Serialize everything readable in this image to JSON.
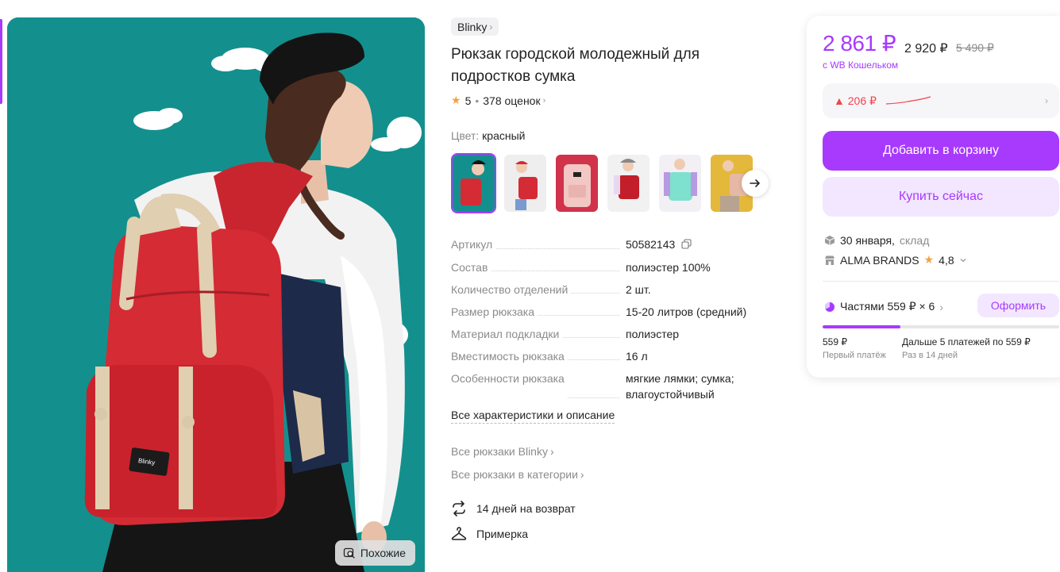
{
  "product": {
    "brand": "Blinky",
    "title": "Рюкзак городской молодежный для подростков сумка",
    "rating": "5",
    "reviews": "378 оценок",
    "color_label": "Цвет:",
    "color_value": "красный",
    "similar_label": "Похожие"
  },
  "specs": [
    {
      "key": "Артикул",
      "value": "50582143"
    },
    {
      "key": "Состав",
      "value": "полиэстер 100%"
    },
    {
      "key": "Количество отделений",
      "value": "2 шт."
    },
    {
      "key": "Размер рюкзака",
      "value": "15-20 литров (средний)"
    },
    {
      "key": "Материал подкладки",
      "value": "полиэстер"
    },
    {
      "key": "Вместимость рюкзака",
      "value": "16 л"
    },
    {
      "key": "Особенности рюкзака",
      "value": "мягкие лямки; сумка; влагоустойчивый"
    }
  ],
  "links": {
    "all_specs": "Все характеристики и описание",
    "all_brand": "Все рюкзаки Blinky",
    "all_category": "Все рюкзаки в категории"
  },
  "features": {
    "return": "14 дней на возврат",
    "fitting": "Примерка"
  },
  "buy": {
    "price_wallet": "2 861 ₽",
    "price": "2 920 ₽",
    "price_old": "5 490 ₽",
    "wallet_note": "с WB Кошельком",
    "price_change": "▲ 206 ₽",
    "add_to_cart": "Добавить в корзину",
    "buy_now": "Купить сейчас",
    "delivery_date": "30 января,",
    "delivery_from": "склад",
    "seller": "ALMA BRANDS",
    "seller_rating": "4,8",
    "installment": "Частями 559 ₽ × 6",
    "apply": "Оформить",
    "progress": 0.33,
    "first_payment": "559 ₽",
    "first_payment_label": "Первый платёж",
    "next_payments": "Дальше 5 платежей по 559 ₽",
    "next_payments_label": "Раз в 14 дней"
  },
  "colors": {
    "accent": "#a73afd",
    "accent_light": "#f3e6ff",
    "photo_bg": "#13908d",
    "backpack_red": "#d42b34",
    "price_up": "#f2434b"
  }
}
